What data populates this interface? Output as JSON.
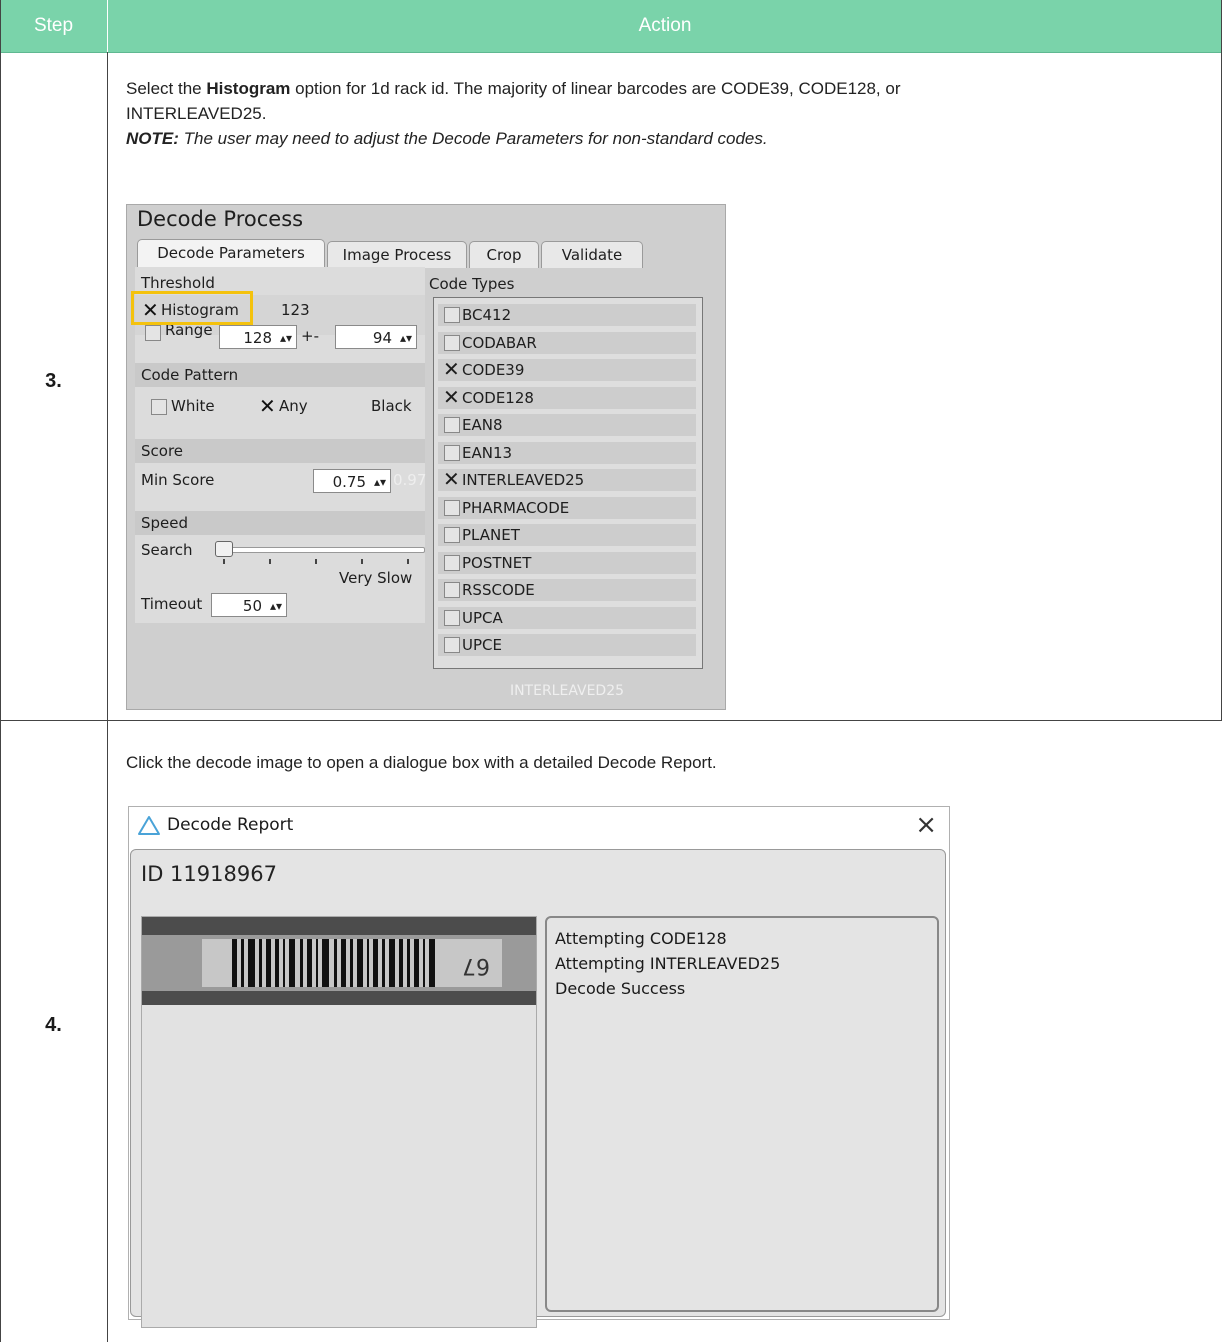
{
  "header": {
    "step": "Step",
    "action": "Action"
  },
  "rows": [
    {
      "step": "3.",
      "text_pre": "Select the ",
      "text_bold": "Histogram",
      "text_post": " option for 1d rack id. The majority of linear barcodes are CODE39, CODE128, or",
      "text_line2": "INTERLEAVED25.",
      "note_label": "NOTE:",
      "note_text": " The user may need to adjust the Decode Parameters for non-standard codes."
    },
    {
      "step": "4.",
      "text": "Click the decode image to open a dialogue box with a detailed Decode Report."
    }
  ],
  "decode_process": {
    "title": "Decode Process",
    "tabs": [
      "Decode Parameters",
      "Image Process",
      "Crop",
      "Validate"
    ],
    "threshold": {
      "label": "Threshold",
      "histogram_label": "Histogram",
      "histogram_checked": true,
      "histogram_value": "123",
      "range_label": "Range",
      "range_checked": false,
      "range_value": "128",
      "plusminus": "+-",
      "pm_value": "94"
    },
    "code_pattern": {
      "label": "Code Pattern",
      "white": "White",
      "any": "Any",
      "black": "Black",
      "any_checked": true
    },
    "score": {
      "label": "Score",
      "min_label": "Min Score",
      "min_value": "0.75",
      "readout": "0.97"
    },
    "speed": {
      "label": "Speed",
      "search_label": "Search",
      "search_level": "Very Slow",
      "timeout_label": "Timeout",
      "timeout_value": "50"
    },
    "code_types": {
      "label": "Code Types",
      "items": [
        {
          "name": "BC412",
          "checked": false
        },
        {
          "name": "CODABAR",
          "checked": false
        },
        {
          "name": "CODE39",
          "checked": true
        },
        {
          "name": "CODE128",
          "checked": true
        },
        {
          "name": "EAN8",
          "checked": false
        },
        {
          "name": "EAN13",
          "checked": false
        },
        {
          "name": "INTERLEAVED25",
          "checked": true
        },
        {
          "name": "PHARMACODE",
          "checked": false
        },
        {
          "name": "PLANET",
          "checked": false
        },
        {
          "name": "POSTNET",
          "checked": false
        },
        {
          "name": "RSSCODE",
          "checked": false
        },
        {
          "name": "UPCA",
          "checked": false
        },
        {
          "name": "UPCE",
          "checked": false
        }
      ],
      "footer": "INTERLEAVED25"
    }
  },
  "decode_report": {
    "title": "Decode Report",
    "close": "×",
    "id_text": "ID 11918967",
    "barcode_digits": "67",
    "log": [
      "Attempting CODE128",
      "Attempting INTERLEAVED25",
      "Decode Success"
    ]
  },
  "colors": {
    "header_bg": "#7ad3aa",
    "highlight": "#f4c20d"
  }
}
